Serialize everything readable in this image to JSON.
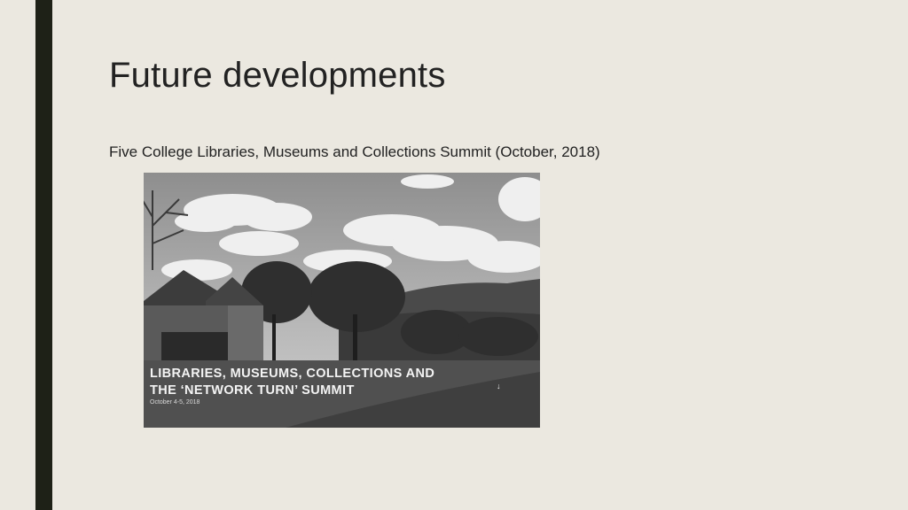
{
  "slide": {
    "title": "Future developments",
    "subtitle": "Five College Libraries, Museums and Collections Summit (October, 2018)"
  },
  "photo": {
    "headline_line1": "LIBRARIES, MUSEUMS, COLLECTIONS AND",
    "headline_line2": "THE ‘NETWORK TURN’ SUMMIT",
    "dates": "October 4-5, 2018",
    "arrow_icon": "down-arrow-icon",
    "arrow_glyph": "↓"
  },
  "colors": {
    "background": "#ebe8e0",
    "accent_bar": "#1e2117",
    "text": "#222222"
  }
}
